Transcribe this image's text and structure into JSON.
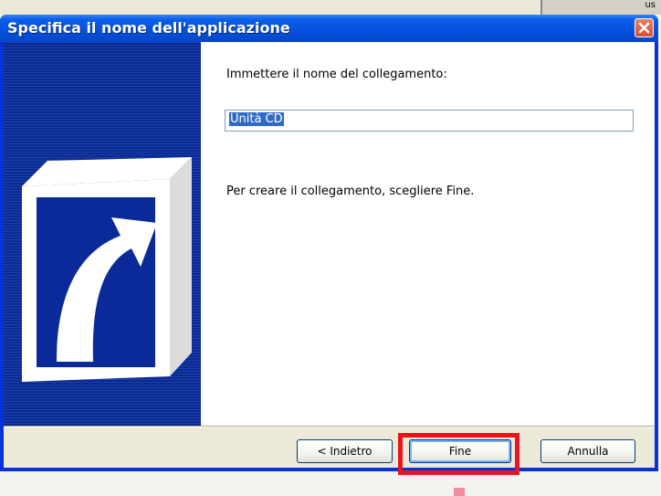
{
  "window": {
    "title": "Specifica il nome dell'applicazione"
  },
  "form": {
    "prompt": "Immettere il nome del collegamento:",
    "name_value": "Unità CD",
    "info": "Per creare il collegamento, scegliere Fine."
  },
  "buttons": {
    "back": "< Indietro",
    "finish": "Fine",
    "cancel": "Annulla"
  },
  "background": {
    "corner_text": "us"
  },
  "colors": {
    "titlebar": "#0552de",
    "banner": "#0a2a9a",
    "highlight": "#e8141e",
    "selection": "#316ac5"
  },
  "icons": [
    "shortcut-arrow-icon",
    "close-icon"
  ]
}
